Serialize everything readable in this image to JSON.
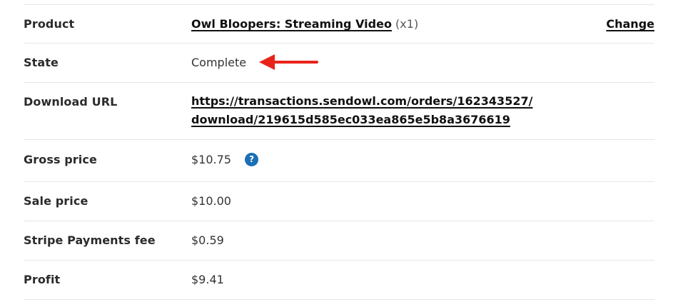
{
  "rows": {
    "product": {
      "label": "Product",
      "name": "Owl Bloopers: Streaming Video",
      "quantity": "(x1)",
      "action": "Change"
    },
    "state": {
      "label": "State",
      "value": "Complete"
    },
    "download_url": {
      "label": "Download URL",
      "line1": "https://transactions.sendowl.com/orders/162343527/",
      "line2": "download/219615d585ec033ea865e5b8a3676619"
    },
    "gross_price": {
      "label": "Gross price",
      "value": "$10.75",
      "help_glyph": "?"
    },
    "sale_price": {
      "label": "Sale price",
      "value": "$10.00"
    },
    "stripe_fee": {
      "label": "Stripe Payments fee",
      "value": "$0.59"
    },
    "profit": {
      "label": "Profit",
      "value": "$9.41"
    }
  },
  "icons": {
    "help": "question-circle-icon",
    "annotation": "red-arrow-left-icon"
  },
  "colors": {
    "help_icon": "#1a6fb5",
    "arrow": "#e8231a",
    "divider": "#e6e6e6"
  }
}
